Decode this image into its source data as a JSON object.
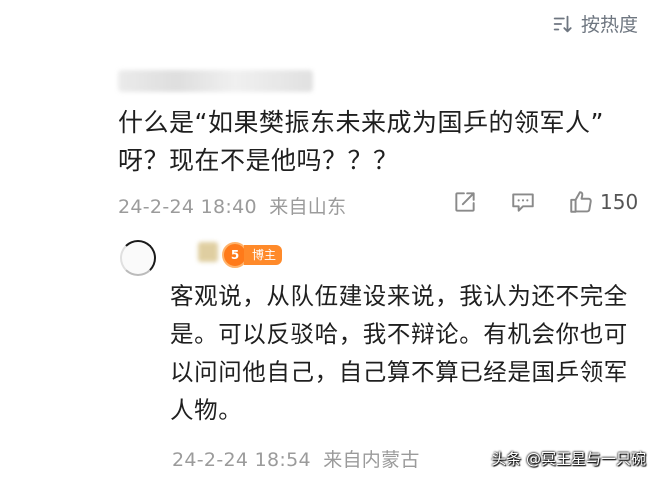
{
  "sort": {
    "label": "按热度",
    "icon": "sort-icon"
  },
  "comment": {
    "text_line1": "什么是“如果樊振东未来成为国乒的领军人”",
    "text_line2": "呀？现在不是他吗？？？",
    "timestamp": "24-2-24 18:40",
    "location": "来自山东",
    "likes": "150"
  },
  "reply": {
    "badge_number": "5",
    "badge_label": "博主",
    "text": "客观说，从队伍建设来说，我认为还不完全是。可以反驳哈，我不辩论。有机会你也可以问问他自己，自己算不算已经是国乒领军人物。",
    "timestamp": "24-2-24 18:54",
    "location": "来自内蒙古"
  },
  "watermark": {
    "text": "头条 @冥王星与一只碗"
  },
  "colors": {
    "meta_gray": "#9b9b9b",
    "badge_orange": "#ff8a2a"
  }
}
